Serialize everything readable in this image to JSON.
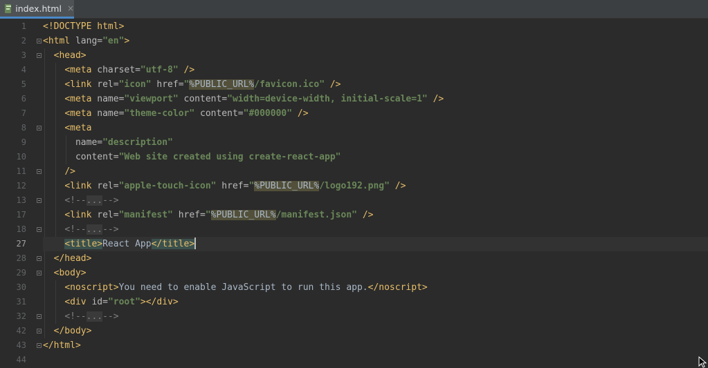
{
  "tab": {
    "label": "index.html",
    "close_glyph": "×",
    "icon": "html-file-icon"
  },
  "current_line": "27",
  "lines": [
    {
      "num": "1",
      "fold": false,
      "indent": 0,
      "tokens": [
        [
          "t",
          "<!DOCTYPE html>"
        ]
      ]
    },
    {
      "num": "2",
      "fold": true,
      "indent": 0,
      "tokens": [
        [
          "t",
          "<html "
        ],
        [
          "a",
          "lang="
        ],
        [
          "v",
          "\"en\""
        ],
        [
          "t",
          ">"
        ]
      ]
    },
    {
      "num": "3",
      "fold": true,
      "indent": 1,
      "tokens": [
        [
          "t",
          "<head>"
        ]
      ]
    },
    {
      "num": "4",
      "fold": false,
      "indent": 2,
      "tokens": [
        [
          "t",
          "<meta "
        ],
        [
          "a",
          "charset="
        ],
        [
          "v",
          "\"utf-8\""
        ],
        [
          "t",
          " />"
        ]
      ]
    },
    {
      "num": "5",
      "fold": false,
      "indent": 2,
      "tokens": [
        [
          "t",
          "<link "
        ],
        [
          "a",
          "rel="
        ],
        [
          "v",
          "\"icon\""
        ],
        [
          "a",
          " href="
        ],
        [
          "v",
          "\""
        ],
        [
          "pu",
          "%PUBLIC_URL%"
        ],
        [
          "v",
          "/favicon.ico\""
        ],
        [
          "t",
          " />"
        ]
      ]
    },
    {
      "num": "6",
      "fold": false,
      "indent": 2,
      "tokens": [
        [
          "t",
          "<meta "
        ],
        [
          "a",
          "name="
        ],
        [
          "v",
          "\"viewport\""
        ],
        [
          "a",
          " content="
        ],
        [
          "v",
          "\"width=device-width, initial-scale=1\""
        ],
        [
          "t",
          " />"
        ]
      ]
    },
    {
      "num": "7",
      "fold": false,
      "indent": 2,
      "tokens": [
        [
          "t",
          "<meta "
        ],
        [
          "a",
          "name="
        ],
        [
          "v",
          "\"theme-color\""
        ],
        [
          "a",
          " content="
        ],
        [
          "v",
          "\"#000000\""
        ],
        [
          "t",
          " />"
        ]
      ]
    },
    {
      "num": "8",
      "fold": true,
      "indent": 2,
      "tokens": [
        [
          "t",
          "<meta"
        ]
      ]
    },
    {
      "num": "9",
      "fold": false,
      "indent": 3,
      "tokens": [
        [
          "a",
          "name="
        ],
        [
          "v",
          "\"description\""
        ]
      ]
    },
    {
      "num": "10",
      "fold": false,
      "indent": 3,
      "tokens": [
        [
          "a",
          "content="
        ],
        [
          "v",
          "\"Web site created using create-react-app\""
        ]
      ]
    },
    {
      "num": "11",
      "fold": true,
      "indent": 2,
      "tokens": [
        [
          "t",
          "/>"
        ]
      ]
    },
    {
      "num": "12",
      "fold": false,
      "indent": 2,
      "tokens": [
        [
          "t",
          "<link "
        ],
        [
          "a",
          "rel="
        ],
        [
          "v",
          "\"apple-touch-icon\""
        ],
        [
          "a",
          " href="
        ],
        [
          "v",
          "\""
        ],
        [
          "pu",
          "%PUBLIC_URL%"
        ],
        [
          "v",
          "/logo192.png\""
        ],
        [
          "t",
          " />"
        ]
      ]
    },
    {
      "num": "13",
      "fold": true,
      "indent": 2,
      "tokens": [
        [
          "cm",
          "<!--"
        ],
        [
          "fd",
          "..."
        ],
        [
          "cm",
          "-->"
        ]
      ]
    },
    {
      "num": "17",
      "fold": false,
      "indent": 2,
      "tokens": [
        [
          "t",
          "<link "
        ],
        [
          "a",
          "rel="
        ],
        [
          "v",
          "\"manifest\""
        ],
        [
          "a",
          " href="
        ],
        [
          "v",
          "\""
        ],
        [
          "pu",
          "%PUBLIC_URL%"
        ],
        [
          "v",
          "/manifest.json\""
        ],
        [
          "t",
          " />"
        ]
      ]
    },
    {
      "num": "18",
      "fold": true,
      "indent": 2,
      "tokens": [
        [
          "cm",
          "<!--"
        ],
        [
          "fd",
          "..."
        ],
        [
          "cm",
          "-->"
        ]
      ]
    },
    {
      "num": "27",
      "fold": false,
      "indent": 2,
      "tokens": [
        [
          "thl",
          "<title>"
        ],
        [
          "txt",
          "React App"
        ],
        [
          "thl",
          "</title>"
        ],
        [
          "caret",
          ""
        ]
      ]
    },
    {
      "num": "28",
      "fold": true,
      "indent": 1,
      "tokens": [
        [
          "t",
          "</head>"
        ]
      ]
    },
    {
      "num": "29",
      "fold": true,
      "indent": 1,
      "tokens": [
        [
          "t",
          "<body>"
        ]
      ]
    },
    {
      "num": "30",
      "fold": false,
      "indent": 2,
      "tokens": [
        [
          "t",
          "<noscript>"
        ],
        [
          "txt",
          "You need to enable JavaScript to run this app."
        ],
        [
          "t",
          "</noscript>"
        ]
      ]
    },
    {
      "num": "31",
      "fold": false,
      "indent": 2,
      "tokens": [
        [
          "t",
          "<div "
        ],
        [
          "a",
          "id="
        ],
        [
          "v",
          "\"root\""
        ],
        [
          "t",
          "></div>"
        ]
      ]
    },
    {
      "num": "32",
      "fold": true,
      "indent": 2,
      "tokens": [
        [
          "cm",
          "<!--"
        ],
        [
          "fd",
          "..."
        ],
        [
          "cm",
          "-->"
        ]
      ]
    },
    {
      "num": "42",
      "fold": true,
      "indent": 1,
      "tokens": [
        [
          "t",
          "</body>"
        ]
      ]
    },
    {
      "num": "43",
      "fold": true,
      "indent": 0,
      "tokens": [
        [
          "t",
          "</html>"
        ]
      ]
    },
    {
      "num": "44",
      "fold": false,
      "indent": 0,
      "tokens": []
    }
  ]
}
